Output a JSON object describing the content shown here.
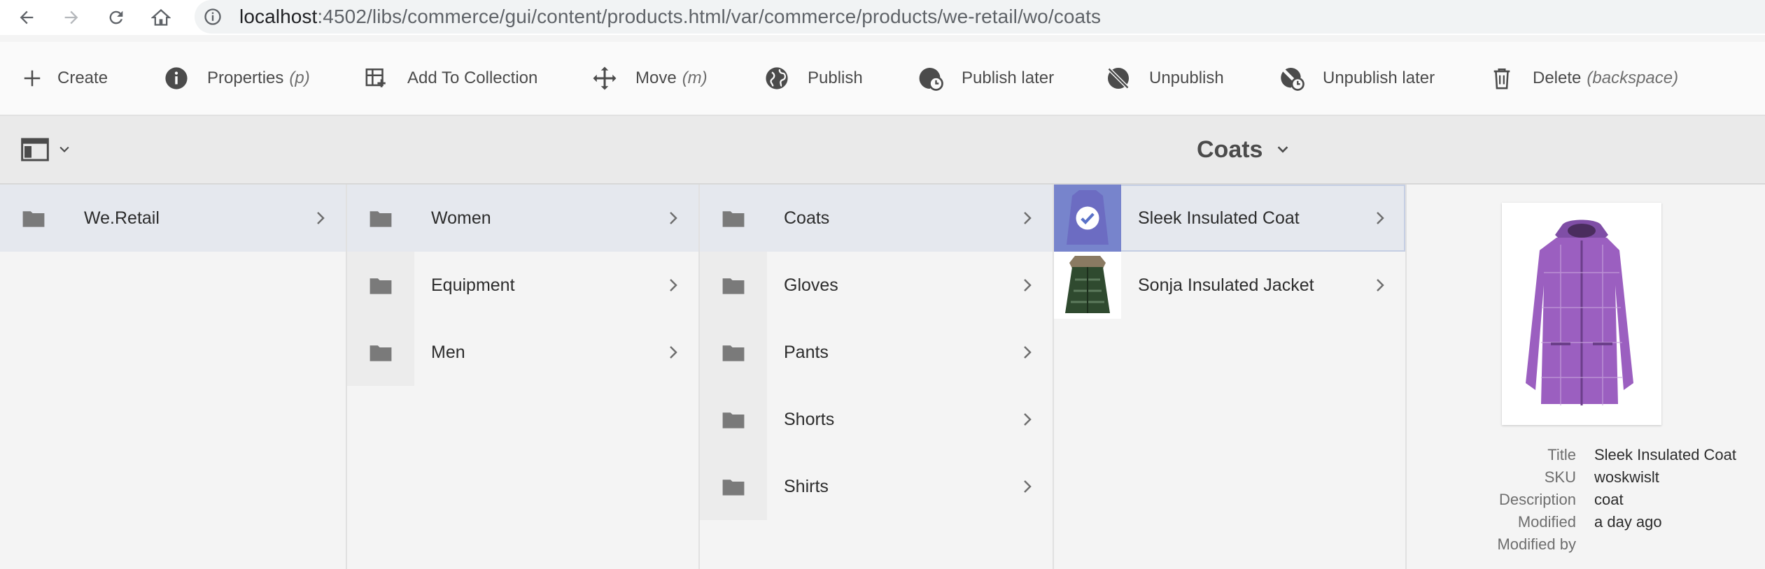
{
  "browser": {
    "url_host": "localhost",
    "url_path": ":4502/libs/commerce/gui/content/products.html/var/commerce/products/we-retail/wo/coats"
  },
  "actions": [
    {
      "label": "Create",
      "key": ""
    },
    {
      "label": "Properties",
      "key": "(p)"
    },
    {
      "label": "Add To Collection",
      "key": ""
    },
    {
      "label": "Move",
      "key": "(m)"
    },
    {
      "label": "Publish",
      "key": ""
    },
    {
      "label": "Publish later",
      "key": ""
    },
    {
      "label": "Unpublish",
      "key": ""
    },
    {
      "label": "Unpublish later",
      "key": ""
    },
    {
      "label": "Delete",
      "key": "(backspace)"
    }
  ],
  "header": {
    "title": "Coats"
  },
  "columns": {
    "root": [
      {
        "label": "We.Retail"
      }
    ],
    "level1": [
      {
        "label": "Women"
      },
      {
        "label": "Equipment"
      },
      {
        "label": "Men"
      }
    ],
    "level2": [
      {
        "label": "Coats"
      },
      {
        "label": "Gloves"
      },
      {
        "label": "Pants"
      },
      {
        "label": "Shorts"
      },
      {
        "label": "Shirts"
      }
    ],
    "products": [
      {
        "label": "Sleek Insulated Coat",
        "selected": true
      },
      {
        "label": "Sonja Insulated Jacket",
        "selected": false
      }
    ]
  },
  "preview": {
    "meta": [
      {
        "key": "Title",
        "value": "Sleek Insulated Coat"
      },
      {
        "key": "SKU",
        "value": "woskwislt"
      },
      {
        "key": "Description",
        "value": "coat"
      },
      {
        "key": "Modified",
        "value": "a day ago"
      },
      {
        "key": "Modified by",
        "value": ""
      }
    ]
  },
  "colors": {
    "selection": "#e5e8ee",
    "selected_thumb_overlay": "#5a72c8",
    "coat_purple": "#9b5fc0",
    "jacket_green": "#2f4a2f"
  }
}
